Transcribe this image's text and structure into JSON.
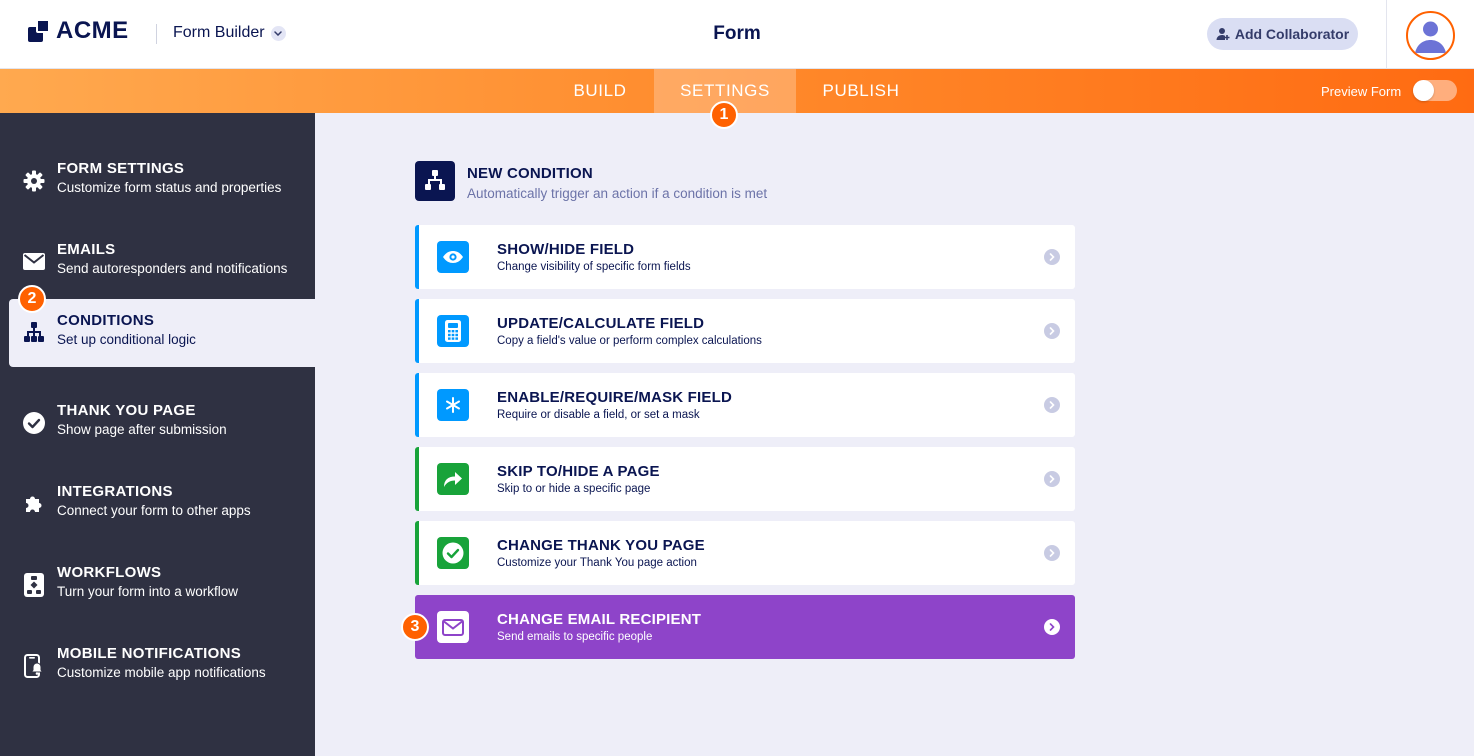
{
  "header": {
    "logo_text": "ACME",
    "builder_label": "Form Builder",
    "page_title": "Form",
    "collaborator_button": "Add Collaborator"
  },
  "nav": {
    "tabs": [
      {
        "label": "BUILD",
        "active": false
      },
      {
        "label": "SETTINGS",
        "active": true
      },
      {
        "label": "PUBLISH",
        "active": false
      }
    ],
    "preview_label": "Preview Form",
    "preview_on": false
  },
  "steps": [
    "1",
    "2",
    "3"
  ],
  "sidebar": {
    "items": [
      {
        "title": "FORM SETTINGS",
        "subtitle": "Customize form status and properties",
        "icon": "gear-icon"
      },
      {
        "title": "EMAILS",
        "subtitle": "Send autoresponders and notifications",
        "icon": "envelope-icon"
      },
      {
        "title": "CONDITIONS",
        "subtitle": "Set up conditional logic",
        "icon": "hierarchy-icon",
        "active": true
      },
      {
        "title": "THANK YOU PAGE",
        "subtitle": "Show page after submission",
        "icon": "check-circle-icon"
      },
      {
        "title": "INTEGRATIONS",
        "subtitle": "Connect your form to other apps",
        "icon": "puzzle-icon"
      },
      {
        "title": "WORKFLOWS",
        "subtitle": "Turn your form into a workflow",
        "icon": "workflow-icon"
      },
      {
        "title": "MOBILE NOTIFICATIONS",
        "subtitle": "Customize mobile app notifications",
        "icon": "mobile-bell-icon"
      }
    ]
  },
  "main": {
    "new_condition": {
      "title": "NEW CONDITION",
      "subtitle": "Automatically trigger an action if a condition is met"
    },
    "cards": [
      {
        "title": "SHOW/HIDE FIELD",
        "subtitle": "Change visibility of specific form fields",
        "icon": "eye-icon",
        "color": "#0099ff"
      },
      {
        "title": "UPDATE/CALCULATE FIELD",
        "subtitle": "Copy a field's value or perform complex calculations",
        "icon": "calculator-icon",
        "color": "#0099ff"
      },
      {
        "title": "ENABLE/REQUIRE/MASK FIELD",
        "subtitle": "Require or disable a field, or set a mask",
        "icon": "asterisk-icon",
        "color": "#0099ff"
      },
      {
        "title": "SKIP TO/HIDE A PAGE",
        "subtitle": "Skip to or hide a specific page",
        "icon": "skip-arrow-icon",
        "color": "#18a33a"
      },
      {
        "title": "CHANGE THANK YOU PAGE",
        "subtitle": "Customize your Thank You page action",
        "icon": "check-circle-icon",
        "color": "#18a33a"
      },
      {
        "title": "CHANGE EMAIL RECIPIENT",
        "subtitle": "Send emails to specific people",
        "icon": "envelope-icon",
        "color": "#8e44c9"
      }
    ]
  },
  "colors": {
    "accent_orange": "#ff6100",
    "navy": "#0a1551",
    "sidebar_bg": "#2f3142",
    "blue": "#0099ff",
    "green": "#18a33a",
    "purple": "#8e44c9"
  }
}
